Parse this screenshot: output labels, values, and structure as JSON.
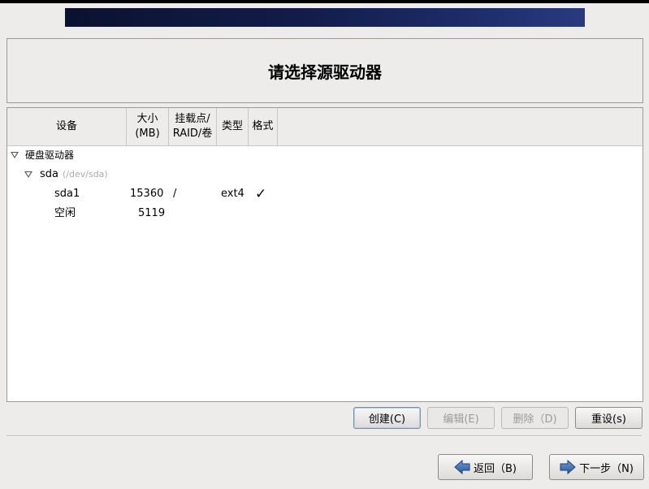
{
  "title": "请选择源驱动器",
  "columns": {
    "device": "设备",
    "size_line1": "大小",
    "size_line2": "(MB)",
    "mount_line1": "挂载点/",
    "mount_line2": "RAID/卷",
    "type": "类型",
    "format": "格式"
  },
  "tree": {
    "group": "硬盘驱动器",
    "disk": {
      "name": "sda",
      "path": "(/dev/sda)"
    },
    "rows": [
      {
        "device": "sda1",
        "size": "15360",
        "mount": "/",
        "type": "ext4",
        "format": "✓"
      },
      {
        "device": "空闲",
        "size": "5119",
        "mount": "",
        "type": "",
        "format": ""
      }
    ]
  },
  "actions": {
    "create": "创建(C)",
    "edit": "编辑(E)",
    "delete": "删除（D)",
    "reset": "重设(s)"
  },
  "nav": {
    "back": "返回（B)",
    "next": "下一步（N)"
  },
  "icons": {
    "expand": "triangle-down-icon",
    "back": "arrow-left-icon",
    "next": "arrow-right-icon",
    "check": "checkmark-icon"
  }
}
